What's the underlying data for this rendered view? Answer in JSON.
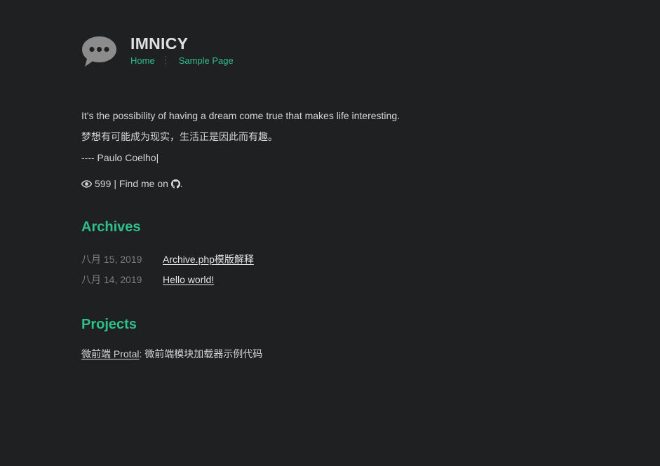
{
  "site": {
    "title": "IMNICY",
    "nav": [
      {
        "label": "Home"
      },
      {
        "label": "Sample Page"
      }
    ]
  },
  "quote": {
    "english": "It's the possibility of having a dream come true that makes life interesting.",
    "chinese": "梦想有可能成为现实，生活正是因此而有趣。",
    "author": "---- Paulo Coelho|"
  },
  "meta": {
    "eye_icon": "eye-icon",
    "views": "599",
    "find_text": "| Find me on",
    "github_icon": "github-icon",
    "period": "."
  },
  "archives": {
    "heading": "Archives",
    "items": [
      {
        "date": "八月 15, 2019",
        "title": "Archive.php模版解释"
      },
      {
        "date": "八月 14, 2019",
        "title": "Hello world!"
      }
    ]
  },
  "projects": {
    "heading": "Projects",
    "items": [
      {
        "name": "微前端 Protal",
        "description": ": 微前端模块加载器示例代码"
      }
    ]
  },
  "colors": {
    "background": "#1f2022",
    "accent": "#2fbf8a",
    "text": "#d4d4d4",
    "muted": "#7d7d7d"
  }
}
